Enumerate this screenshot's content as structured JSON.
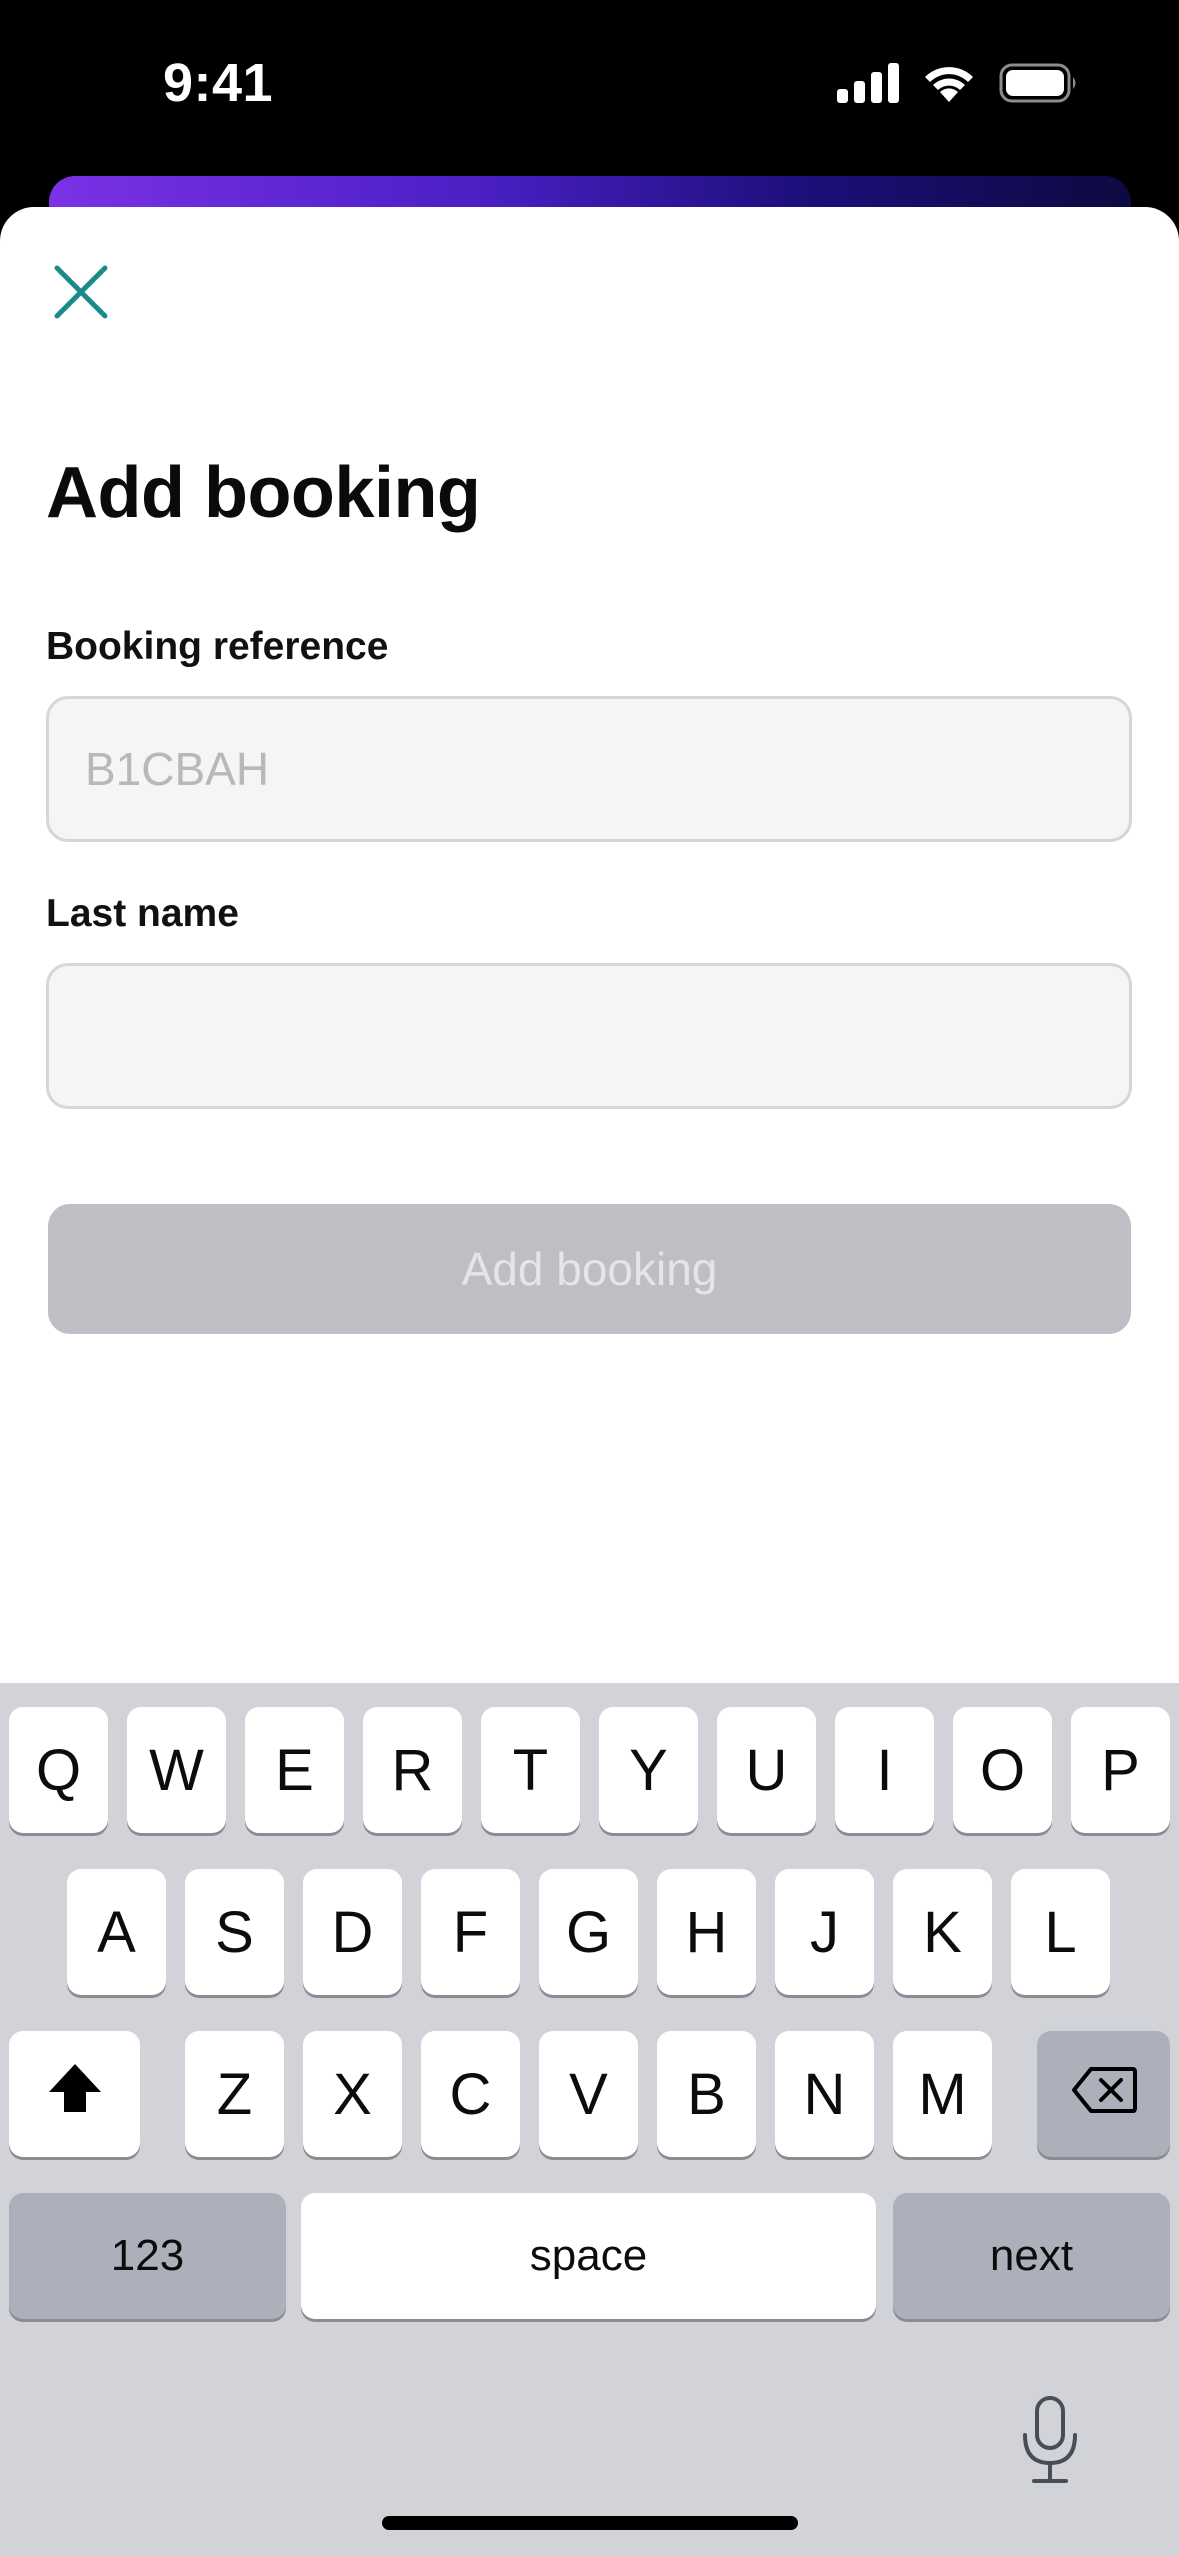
{
  "status_bar": {
    "time": "9:41"
  },
  "sheet": {
    "title": "Add booking",
    "booking_reference": {
      "label": "Booking reference",
      "placeholder": "B1CBAH",
      "value": ""
    },
    "last_name": {
      "label": "Last name",
      "placeholder": "",
      "value": ""
    },
    "submit_label": "Add booking"
  },
  "keyboard": {
    "row1": [
      "Q",
      "W",
      "E",
      "R",
      "T",
      "Y",
      "U",
      "I",
      "O",
      "P"
    ],
    "row2": [
      "A",
      "S",
      "D",
      "F",
      "G",
      "H",
      "J",
      "K",
      "L"
    ],
    "row3": [
      "Z",
      "X",
      "C",
      "V",
      "B",
      "N",
      "M"
    ],
    "numbers_label": "123",
    "space_label": "space",
    "return_label": "next"
  },
  "colors": {
    "accent": "#1a8a8a",
    "button_disabled_bg": "#c0bec4",
    "keyboard_bg": "#d1d3d9"
  }
}
